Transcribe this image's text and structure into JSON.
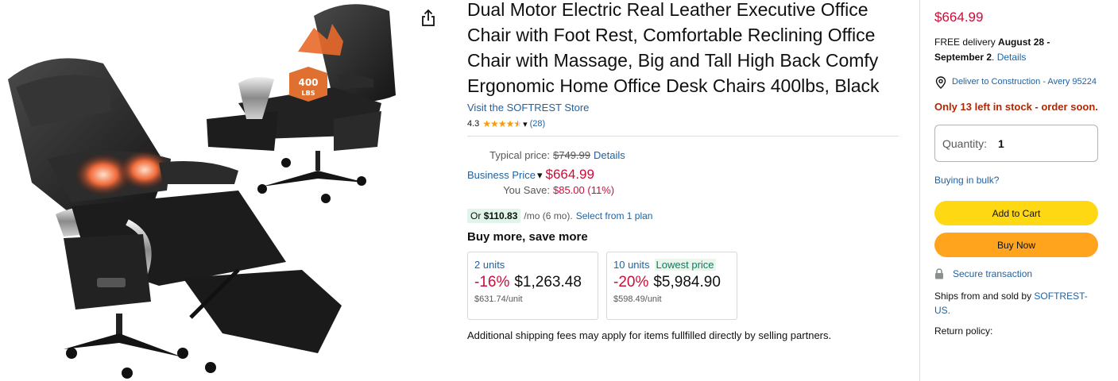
{
  "product": {
    "title": "Dual Motor Electric Real Leather Executive Office Chair with Foot Rest, Comfortable Reclining Office Chair with Massage, Big and Tall High Back Comfy Ergonomic Home Office Desk Chairs 400lbs, Black",
    "store_link": "Visit the SOFTREST Store",
    "rating": "4.3",
    "rating_stars": 4.3,
    "rating_count": "(28)",
    "image_badge_line1": "400",
    "image_badge_line2": "LBS"
  },
  "pricing": {
    "typical_label": "Typical price:",
    "typical_value": "$749.99",
    "details_link": "Details",
    "business_label": "Business Price",
    "business_value": "$664.99",
    "save_label": "You Save:",
    "save_value": "$85.00 (11%)",
    "monthly_prefix": "Or",
    "monthly_amount": "$110.83",
    "monthly_tail": "/mo (6 mo).",
    "monthly_link": "Select from 1 plan"
  },
  "bulk": {
    "heading": "Buy more, save more",
    "tiers": [
      {
        "units": "2 units",
        "badge": "",
        "pct": "-16%",
        "price": "$1,263.48",
        "unit_price": "$631.74/unit"
      },
      {
        "units": "10 units",
        "badge": "Lowest price",
        "pct": "-20%",
        "price": "$5,984.90",
        "unit_price": "$598.49/unit"
      }
    ],
    "ship_note": "Additional shipping fees may apply for items fullfilled directly by selling partners."
  },
  "buybox": {
    "price": "$664.99",
    "delivery_prefix": "FREE delivery",
    "delivery_dates": "August 28 - September 2",
    "delivery_link": "Details",
    "location": "Deliver to Construction - Avery 95224",
    "stock": "Only 13 left in stock - order soon.",
    "qty_label": "Quantity:",
    "qty_value": "1",
    "bulk_link": "Buying in bulk?",
    "add_to_cart": "Add to Cart",
    "buy_now": "Buy Now",
    "secure": "Secure transaction",
    "ships_prefix": "Ships from and sold by",
    "ships_seller": "SOFTREST-US.",
    "return_policy": "Return policy:"
  },
  "colors": {
    "price_red": "#cc0c39",
    "link_blue": "#2162a1",
    "stock_red": "#b12704",
    "cart_yellow": "#ffd814",
    "buy_orange": "#ffa41c",
    "star_orange": "#ff9900"
  },
  "icons": {
    "share": "share-icon",
    "star": "star-icon",
    "chevron": "chevron-down-icon",
    "location": "location-pin-icon",
    "lock": "lock-icon"
  }
}
